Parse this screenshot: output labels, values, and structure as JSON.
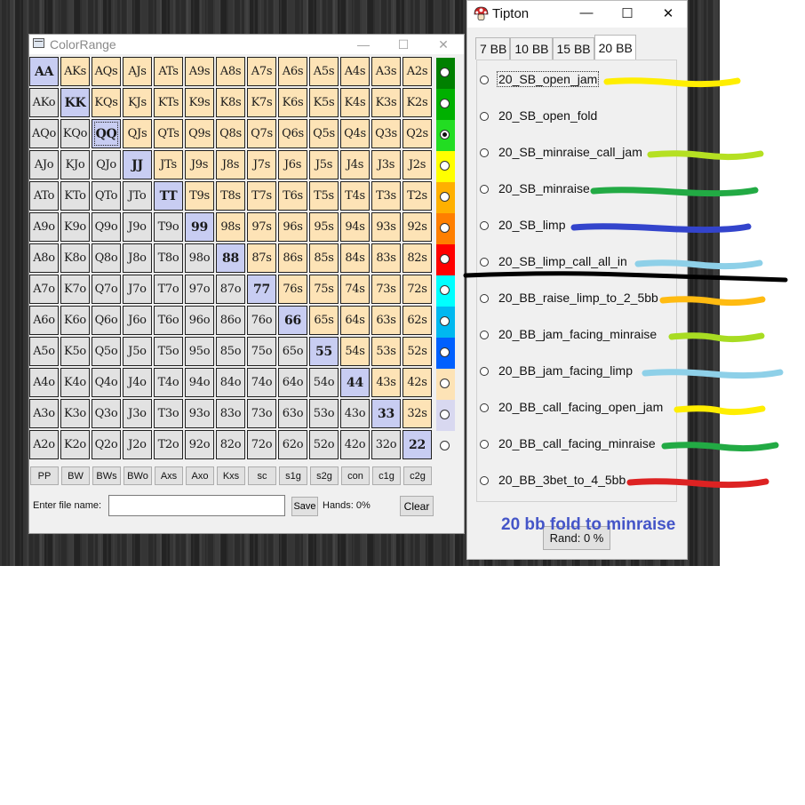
{
  "colorrange": {
    "title": "ColorRange",
    "grid": [
      [
        "AA",
        "AKs",
        "AQs",
        "AJs",
        "ATs",
        "A9s",
        "A8s",
        "A7s",
        "A6s",
        "A5s",
        "A4s",
        "A3s",
        "A2s"
      ],
      [
        "AKo",
        "KK",
        "KQs",
        "KJs",
        "KTs",
        "K9s",
        "K8s",
        "K7s",
        "K6s",
        "K5s",
        "K4s",
        "K3s",
        "K2s"
      ],
      [
        "AQo",
        "KQo",
        "QQ",
        "QJs",
        "QTs",
        "Q9s",
        "Q8s",
        "Q7s",
        "Q6s",
        "Q5s",
        "Q4s",
        "Q3s",
        "Q2s"
      ],
      [
        "AJo",
        "KJo",
        "QJo",
        "JJ",
        "JTs",
        "J9s",
        "J8s",
        "J7s",
        "J6s",
        "J5s",
        "J4s",
        "J3s",
        "J2s"
      ],
      [
        "ATo",
        "KTo",
        "QTo",
        "JTo",
        "TT",
        "T9s",
        "T8s",
        "T7s",
        "T6s",
        "T5s",
        "T4s",
        "T3s",
        "T2s"
      ],
      [
        "A9o",
        "K9o",
        "Q9o",
        "J9o",
        "T9o",
        "99",
        "98s",
        "97s",
        "96s",
        "95s",
        "94s",
        "93s",
        "92s"
      ],
      [
        "A8o",
        "K8o",
        "Q8o",
        "J8o",
        "T8o",
        "98o",
        "88",
        "87s",
        "86s",
        "85s",
        "84s",
        "83s",
        "82s"
      ],
      [
        "A7o",
        "K7o",
        "Q7o",
        "J7o",
        "T7o",
        "97o",
        "87o",
        "77",
        "76s",
        "75s",
        "74s",
        "73s",
        "72s"
      ],
      [
        "A6o",
        "K6o",
        "Q6o",
        "J6o",
        "T6o",
        "96o",
        "86o",
        "76o",
        "66",
        "65s",
        "64s",
        "63s",
        "62s"
      ],
      [
        "A5o",
        "K5o",
        "Q5o",
        "J5o",
        "T5o",
        "95o",
        "85o",
        "75o",
        "65o",
        "55",
        "54s",
        "53s",
        "52s"
      ],
      [
        "A4o",
        "K4o",
        "Q4o",
        "J4o",
        "T4o",
        "94o",
        "84o",
        "74o",
        "64o",
        "54o",
        "44",
        "43s",
        "42s"
      ],
      [
        "A3o",
        "K3o",
        "Q3o",
        "J3o",
        "T3o",
        "93o",
        "83o",
        "73o",
        "63o",
        "53o",
        "43o",
        "33",
        "32s"
      ],
      [
        "A2o",
        "K2o",
        "Q2o",
        "J2o",
        "T2o",
        "92o",
        "82o",
        "72o",
        "62o",
        "52o",
        "42o",
        "32o",
        "22"
      ]
    ],
    "cell_colors": {
      "pair": "#c8cdf2",
      "suited": "#fde3b6",
      "offsuit": "#e2e2e2"
    },
    "color_options": [
      {
        "color": "#008000",
        "checked": false
      },
      {
        "color": "#00b000",
        "checked": false
      },
      {
        "color": "#22dd22",
        "checked": true
      },
      {
        "color": "#ffff00",
        "checked": false
      },
      {
        "color": "#ffb000",
        "checked": false
      },
      {
        "color": "#ff7f00",
        "checked": false
      },
      {
        "color": "#ff0000",
        "checked": false
      },
      {
        "color": "#00ffff",
        "checked": false
      },
      {
        "color": "#00b8f0",
        "checked": false
      },
      {
        "color": "#0060ff",
        "checked": false
      },
      {
        "color": "#fde3b6",
        "checked": false
      },
      {
        "color": "#d8d8f0",
        "checked": false
      },
      {
        "color": "#f0f0f0",
        "checked": false
      }
    ],
    "buttons": [
      "PP",
      "BW",
      "BWs",
      "BWo",
      "Axs",
      "Axo",
      "Kxs",
      "sc",
      "s1g",
      "s2g",
      "con",
      "c1g",
      "c2g"
    ],
    "file_label": "Enter file name:",
    "file_value": "",
    "save_label": "Save",
    "hands_label": "Hands: 0%",
    "clear_label": "Clear"
  },
  "tipton": {
    "title": "Tipton",
    "tabs": [
      "7 BB",
      "10 BB",
      "15 BB",
      "20 BB"
    ],
    "active_tab": "20 BB",
    "options": [
      {
        "label": "20_SB_open_jam",
        "mark": "#ffee00"
      },
      {
        "label": "20_SB_open_fold",
        "mark": ""
      },
      {
        "label": "20_SB_minraise_call_jam",
        "mark": "#b5e022"
      },
      {
        "label": "20_SB_minraise",
        "mark": "#22aa44"
      },
      {
        "label": "20_SB_limp",
        "mark": "#3344cc"
      },
      {
        "label": "20_SB_limp_call_all_in",
        "mark": "#8ed0e8"
      },
      {
        "label": "20_BB_raise_limp_to_2_5bb",
        "mark": "#ffbb11"
      },
      {
        "label": "20_BB_jam_facing_minraise",
        "mark": "#a8dc22"
      },
      {
        "label": "20_BB_jam_facing_limp",
        "mark": "#8ed0e8"
      },
      {
        "label": "20_BB_call_facing_open_jam",
        "mark": "#ffee00"
      },
      {
        "label": "20_BB_call_facing_minraise",
        "mark": "#22aa44"
      },
      {
        "label": "20_BB_3bet_to_4_5bb",
        "mark": "#dd2222"
      }
    ],
    "rand_label": "Rand: 0 %"
  },
  "annotation": {
    "caption": "20 bb fold to minraise",
    "caption_color": "#4455c8",
    "divider_color": "#000000"
  }
}
